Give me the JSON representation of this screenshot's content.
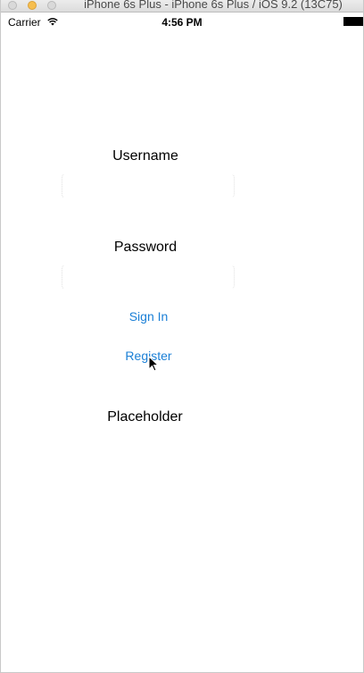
{
  "window": {
    "title": "iPhone 6s Plus - iPhone 6s Plus / iOS 9.2 (13C75)"
  },
  "statusbar": {
    "carrier": "Carrier",
    "time": "4:56 PM",
    "wifi_icon": "wifi-icon",
    "battery_icon": "battery-icon"
  },
  "form": {
    "username_label": "Username",
    "username_value": "",
    "password_label": "Password",
    "password_value": "",
    "signin_label": "Sign In",
    "register_label": "Register",
    "placeholder_label": "Placeholder"
  },
  "colors": {
    "link": "#1a7fd6",
    "minimize": "#f6be4f"
  }
}
